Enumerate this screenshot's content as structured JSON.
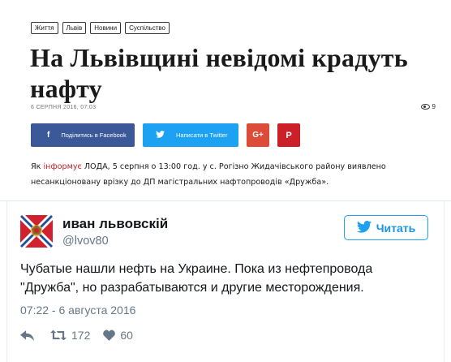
{
  "article": {
    "tags": [
      "Життя",
      "Львів",
      "Новини",
      "Суспільство"
    ],
    "headline": "На Львівщині невідомі крадуть нафту",
    "date": "6 СЕРПНЯ 2016, 07:03",
    "views": "9",
    "share": {
      "facebook_label": "Поділитись в Facebook",
      "twitter_label": "Написати в Twitter",
      "gplus_label": "G+",
      "pinterest_label": "P"
    },
    "body_prefix": "Як ",
    "body_link": "інформує",
    "body_text": " ЛОДА, 5 серпня о 13:00 год. у с. Рогізно Жидачівського району виявлено несанкціоновану врізку до ДП магістральних нафтопроводів «Дружба».",
    "colors": {
      "facebook": "#3b5998",
      "twitter": "#1da1f2",
      "gplus": "#dd4b39",
      "pinterest": "#cb2027",
      "link": "#c0262d"
    }
  },
  "tweet": {
    "name": "иван львовскій",
    "handle": "@lvov80",
    "follow_label": "Читать",
    "text": "Чубатые нашли нефть на Украине. Пока из нефтепровода \"Дружба\", но разрабатываются и другие месторождения.",
    "timestamp": "07:22 - 6 августа 2016",
    "retweets": "172",
    "likes": "60",
    "colors": {
      "accent": "#1da1f2",
      "muted": "#657786"
    }
  }
}
